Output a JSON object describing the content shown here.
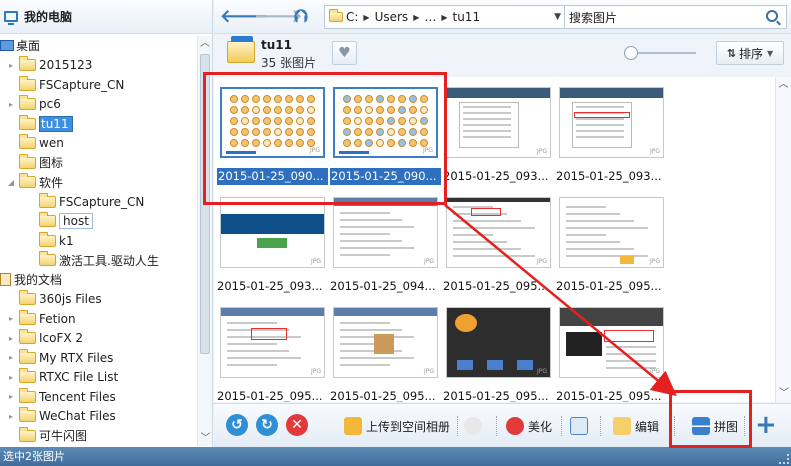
{
  "left_panel": {
    "title": "我的电脑",
    "tree": [
      {
        "label": "桌面",
        "icon": "pc-icon",
        "arrow": "",
        "indent": 0
      },
      {
        "label": "2015123",
        "icon": "folder",
        "arrow": "▸",
        "indent": 1
      },
      {
        "label": "FSCapture_CN",
        "icon": "folder",
        "arrow": "",
        "indent": 1
      },
      {
        "label": "pc6",
        "icon": "folder",
        "arrow": "▸",
        "indent": 1
      },
      {
        "label": "tu11",
        "icon": "folder",
        "arrow": "",
        "indent": 1,
        "selected": true
      },
      {
        "label": "wen",
        "icon": "folder",
        "arrow": "",
        "indent": 1
      },
      {
        "label": "图标",
        "icon": "folder",
        "arrow": "",
        "indent": 1
      },
      {
        "label": "软件",
        "icon": "folder",
        "arrow": "◢",
        "indent": 1
      },
      {
        "label": "FSCapture_CN",
        "icon": "folder",
        "arrow": "",
        "indent": 2
      },
      {
        "label": "host",
        "icon": "folder",
        "arrow": "",
        "indent": 2,
        "boxed": true
      },
      {
        "label": "k1",
        "icon": "folder",
        "arrow": "",
        "indent": 2
      },
      {
        "label": "激活工具.驱动人生",
        "icon": "folder",
        "arrow": "",
        "indent": 2
      },
      {
        "label": "我的文档",
        "icon": "doc-icon",
        "arrow": "",
        "indent": 0
      },
      {
        "label": "360js Files",
        "icon": "folder",
        "arrow": "",
        "indent": 1
      },
      {
        "label": "Fetion",
        "icon": "folder",
        "arrow": "▸",
        "indent": 1
      },
      {
        "label": "IcoFX 2",
        "icon": "folder",
        "arrow": "▸",
        "indent": 1
      },
      {
        "label": "My RTX Files",
        "icon": "folder",
        "arrow": "▸",
        "indent": 1
      },
      {
        "label": "RTXC File List",
        "icon": "folder",
        "arrow": "▸",
        "indent": 1
      },
      {
        "label": "Tencent Files",
        "icon": "folder",
        "arrow": "▸",
        "indent": 1
      },
      {
        "label": "WeChat Files",
        "icon": "folder",
        "arrow": "▸",
        "indent": 1
      },
      {
        "label": "可牛闪图",
        "icon": "folder",
        "arrow": "",
        "indent": 1
      }
    ]
  },
  "topbar": {
    "address": {
      "drive": "C:",
      "seg1": "Users",
      "seg2": "…",
      "seg3": "tu11"
    },
    "search_placeholder": "搜索图片"
  },
  "header": {
    "folder_name": "tu11",
    "count": "35 张图片",
    "sort_label": "排序"
  },
  "grid": {
    "items": [
      {
        "caption": "2015-01-25_090...",
        "selected": true,
        "kind": "emoji"
      },
      {
        "caption": "2015-01-25_090...",
        "selected": true,
        "kind": "emoji2"
      },
      {
        "caption": "2015-01-25_093...",
        "selected": false,
        "kind": "menu"
      },
      {
        "caption": "2015-01-25_093...",
        "selected": false,
        "kind": "menu2"
      },
      {
        "caption": "2015-01-25_093...",
        "selected": false,
        "kind": "blue"
      },
      {
        "caption": "2015-01-25_094...",
        "selected": false,
        "kind": "web"
      },
      {
        "caption": "2015-01-25_095...",
        "selected": false,
        "kind": "text"
      },
      {
        "caption": "2015-01-25_095...",
        "selected": false,
        "kind": "text2"
      },
      {
        "caption": "2015-01-25_095...",
        "selected": false,
        "kind": "web2"
      },
      {
        "caption": "2015-01-25_095...",
        "selected": false,
        "kind": "web3"
      },
      {
        "caption": "2015-01-25_095...",
        "selected": false,
        "kind": "phone"
      },
      {
        "caption": "2015-01-25_095...",
        "selected": false,
        "kind": "phone2"
      }
    ],
    "jpg_tag": "JPG"
  },
  "toolbar": {
    "upload_label": "上传到空间相册",
    "beautify_label": "美化",
    "edit_label": "编辑",
    "collage_label": "拼图"
  },
  "status": {
    "text": "选中2张图片"
  },
  "colors": {
    "accent": "#2f6fbf",
    "annotation": "#e52020"
  }
}
